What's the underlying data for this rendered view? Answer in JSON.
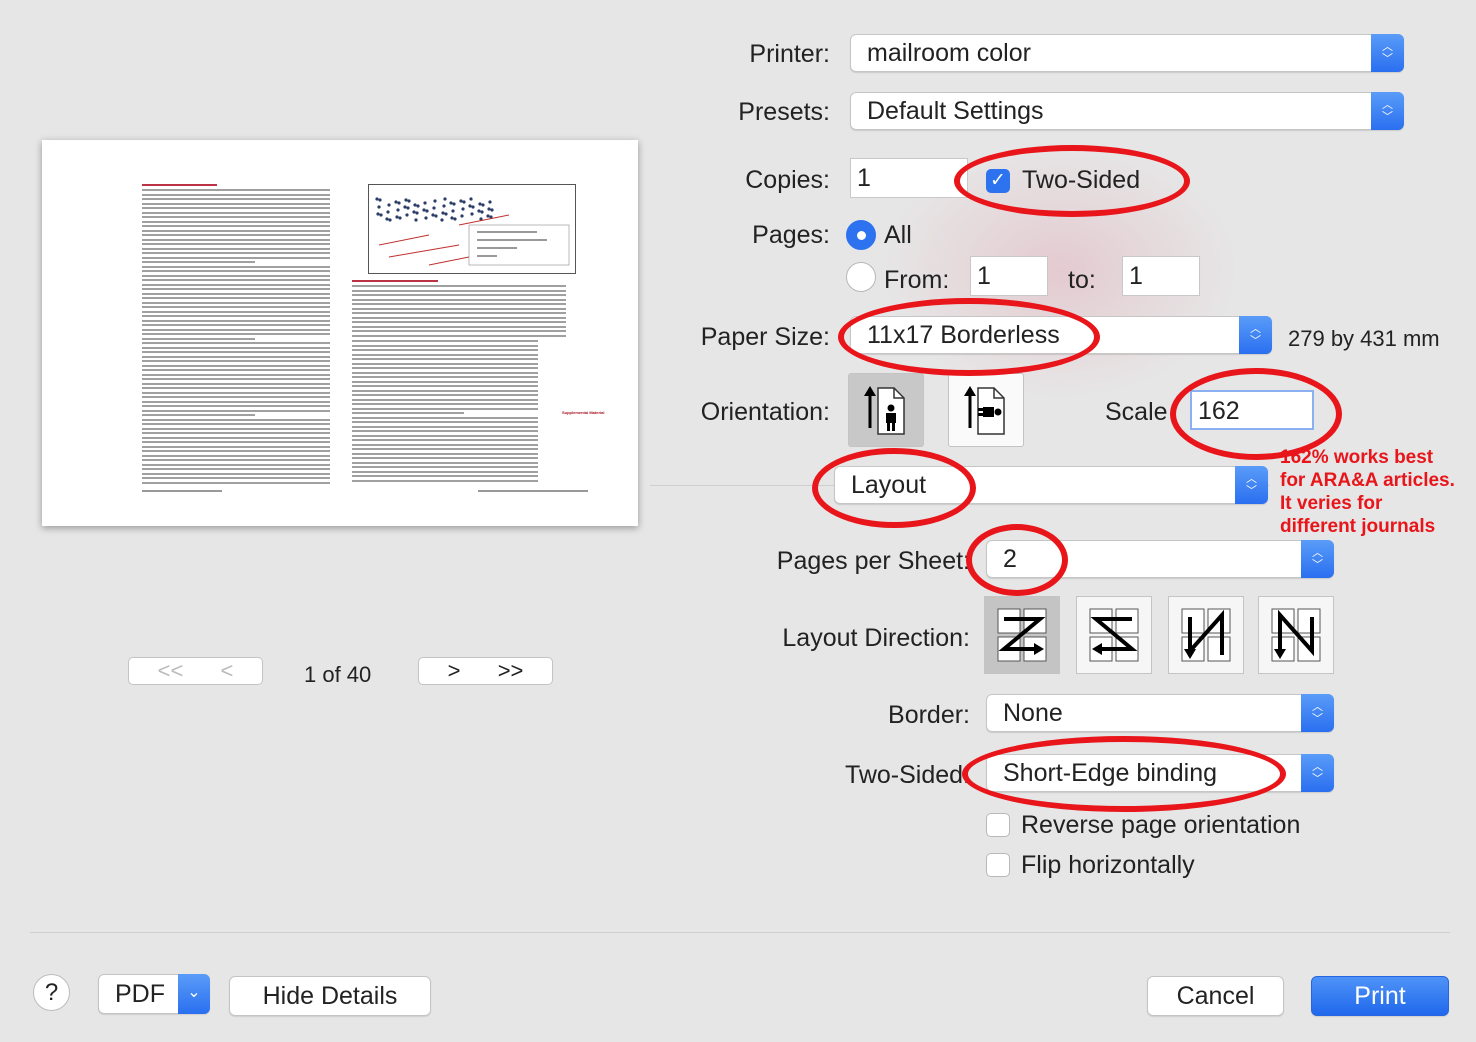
{
  "preview": {
    "supplemental_label": "Supplemental Material",
    "page_counter": "1 of 40",
    "nav": {
      "first": "<<",
      "prev": "<",
      "next": ">",
      "last": ">>"
    }
  },
  "printer": {
    "label": "Printer:",
    "value": "mailroom color"
  },
  "presets": {
    "label": "Presets:",
    "value": "Default Settings"
  },
  "copies": {
    "label": "Copies:",
    "value": "1",
    "two_sided_label": "Two-Sided",
    "two_sided_checked": true
  },
  "pages": {
    "label": "Pages:",
    "all_label": "All",
    "from_label": "From:",
    "from_value": "1",
    "to_label": "to:",
    "to_value": "1",
    "selected": "All"
  },
  "paper_size": {
    "label": "Paper Size:",
    "value": "11x17 Borderless",
    "dimensions": "279 by 431 mm"
  },
  "orientation": {
    "label": "Orientation:",
    "selected": "portrait"
  },
  "scale": {
    "label": "Scale",
    "value": "162"
  },
  "section": {
    "value": "Layout"
  },
  "annotation_note": [
    "162% works best",
    "for ARA&A articles.",
    "It veries for",
    "different journals"
  ],
  "layout": {
    "pages_per_sheet_label": "Pages per Sheet:",
    "pages_per_sheet_value": "2",
    "direction_label": "Layout Direction:",
    "border_label": "Border:",
    "border_value": "None",
    "two_sided_label": "Two-Sided:",
    "two_sided_value": "Short-Edge binding",
    "reverse_label": "Reverse page orientation",
    "reverse_checked": false,
    "flip_label": "Flip horizontally",
    "flip_checked": false
  },
  "footer": {
    "help": "?",
    "pdf": "PDF",
    "hide_details": "Hide Details",
    "cancel": "Cancel",
    "print": "Print"
  },
  "colors": {
    "accent": "#2d72ef",
    "annotation": "#e8151a"
  }
}
